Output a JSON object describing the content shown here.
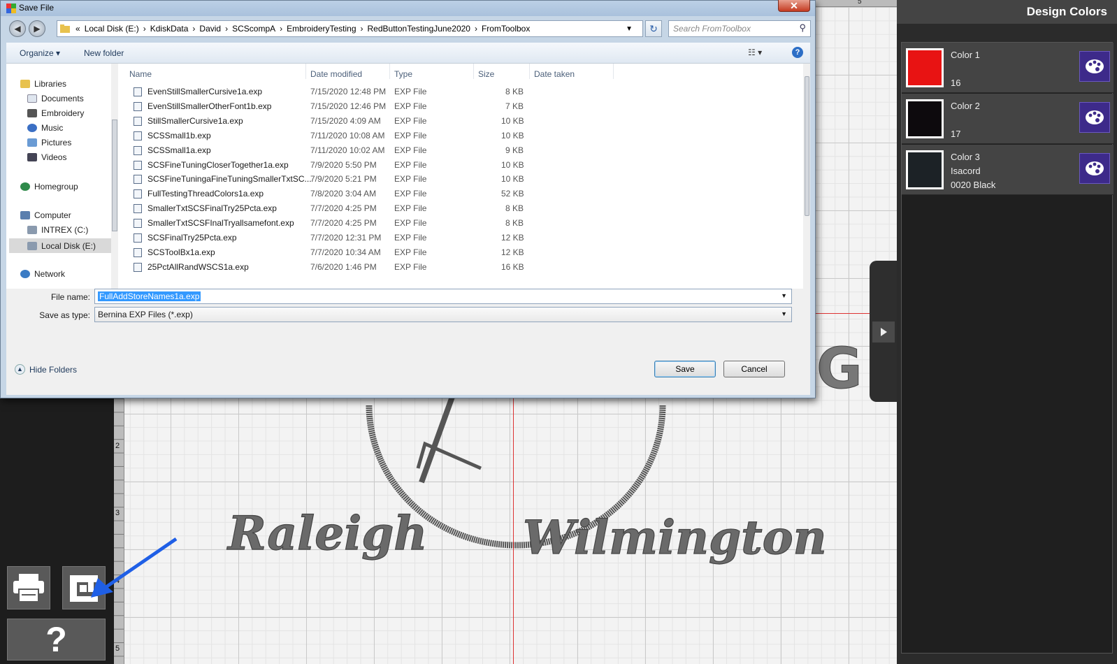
{
  "dialog": {
    "title": "Save File",
    "close_label": "✕",
    "back_label": "◀",
    "forward_label": "▶",
    "address_segments": [
      "«",
      "Local Disk (E:)",
      "›",
      "KdiskData",
      "›",
      "David",
      "›",
      "SCScompA",
      "›",
      "EmbroideryTesting",
      "›",
      "RedButtonTestingJune2020",
      "›",
      "FromToolbox"
    ],
    "refresh_label": "↻",
    "search_placeholder": "Search FromToolbox",
    "organize_label": "Organize ▾",
    "new_folder_label": "New folder",
    "view_label": "☷ ▾",
    "help_label": "?",
    "nav": {
      "libraries": "Libraries",
      "documents": "Documents",
      "embroidery": "Embroidery",
      "music": "Music",
      "pictures": "Pictures",
      "videos": "Videos",
      "homegroup": "Homegroup",
      "computer": "Computer",
      "intrex": "INTREX (C:)",
      "localdisk": "Local Disk (E:)",
      "network": "Network"
    },
    "columns": {
      "name": "Name",
      "date": "Date modified",
      "type": "Type",
      "size": "Size",
      "taken": "Date taken"
    },
    "files": [
      {
        "name": "EvenStillSmallerCursive1a.exp",
        "date": "7/15/2020 12:48 PM",
        "type": "EXP File",
        "size": "8 KB"
      },
      {
        "name": "EvenStillSmallerOtherFont1b.exp",
        "date": "7/15/2020 12:46 PM",
        "type": "EXP File",
        "size": "7 KB"
      },
      {
        "name": "StillSmallerCursive1a.exp",
        "date": "7/15/2020 4:09 AM",
        "type": "EXP File",
        "size": "10 KB"
      },
      {
        "name": "SCSSmall1b.exp",
        "date": "7/11/2020 10:08 AM",
        "type": "EXP File",
        "size": "10 KB"
      },
      {
        "name": "SCSSmall1a.exp",
        "date": "7/11/2020 10:02 AM",
        "type": "EXP File",
        "size": "9 KB"
      },
      {
        "name": "SCSFineTuningCloserTogether1a.exp",
        "date": "7/9/2020 5:50 PM",
        "type": "EXP File",
        "size": "10 KB"
      },
      {
        "name": "SCSFineTuningaFineTuningSmallerTxtSC...",
        "date": "7/9/2020 5:21 PM",
        "type": "EXP File",
        "size": "10 KB"
      },
      {
        "name": "FullTestingThreadColors1a.exp",
        "date": "7/8/2020 3:04 AM",
        "type": "EXP File",
        "size": "52 KB"
      },
      {
        "name": "SmallerTxtSCSFinalTry25Pcta.exp",
        "date": "7/7/2020 4:25 PM",
        "type": "EXP File",
        "size": "8 KB"
      },
      {
        "name": "SmallerTxtSCSFInalTryallsamefont.exp",
        "date": "7/7/2020 4:25 PM",
        "type": "EXP File",
        "size": "8 KB"
      },
      {
        "name": "SCSFinalTry25Pcta.exp",
        "date": "7/7/2020 12:31 PM",
        "type": "EXP File",
        "size": "12 KB"
      },
      {
        "name": "SCSToolBx1a.exp",
        "date": "7/7/2020 10:34 AM",
        "type": "EXP File",
        "size": "12 KB"
      },
      {
        "name": "25PctAllRandWSCS1a.exp",
        "date": "7/6/2020 1:46 PM",
        "type": "EXP File",
        "size": "16 KB"
      }
    ],
    "filename_label": "File name:",
    "filename_value": "FullAddStoreNames1a.exp",
    "savetype_label": "Save as type:",
    "savetype_value": "Bernina EXP Files (*.exp)",
    "hide_folders_label": "Hide Folders",
    "save_label": "Save",
    "cancel_label": "Cancel"
  },
  "canvas": {
    "text_left": "Raleigh",
    "text_right": "Wilmington",
    "text_partial": "G",
    "stitch_color": "#5a5a5a",
    "ruler_numbers": [
      "2",
      "3",
      "4",
      "5"
    ],
    "top_ruler_mark": "5"
  },
  "panel": {
    "title": "Design Colors",
    "colors": [
      {
        "name": "Color 1",
        "line2": "",
        "line3": "16",
        "hex": "#e81313"
      },
      {
        "name": "Color 2",
        "line2": "",
        "line3": "17",
        "hex": "#0d0a0d"
      },
      {
        "name": "Color 3",
        "line2": "Isacord",
        "line3": "0020 Black",
        "hex": "#1c2226"
      }
    ],
    "accent": "#3d2a8a"
  },
  "toolbar": {
    "help_label": "?"
  },
  "annotation": {
    "color": "#1f5fe6"
  }
}
